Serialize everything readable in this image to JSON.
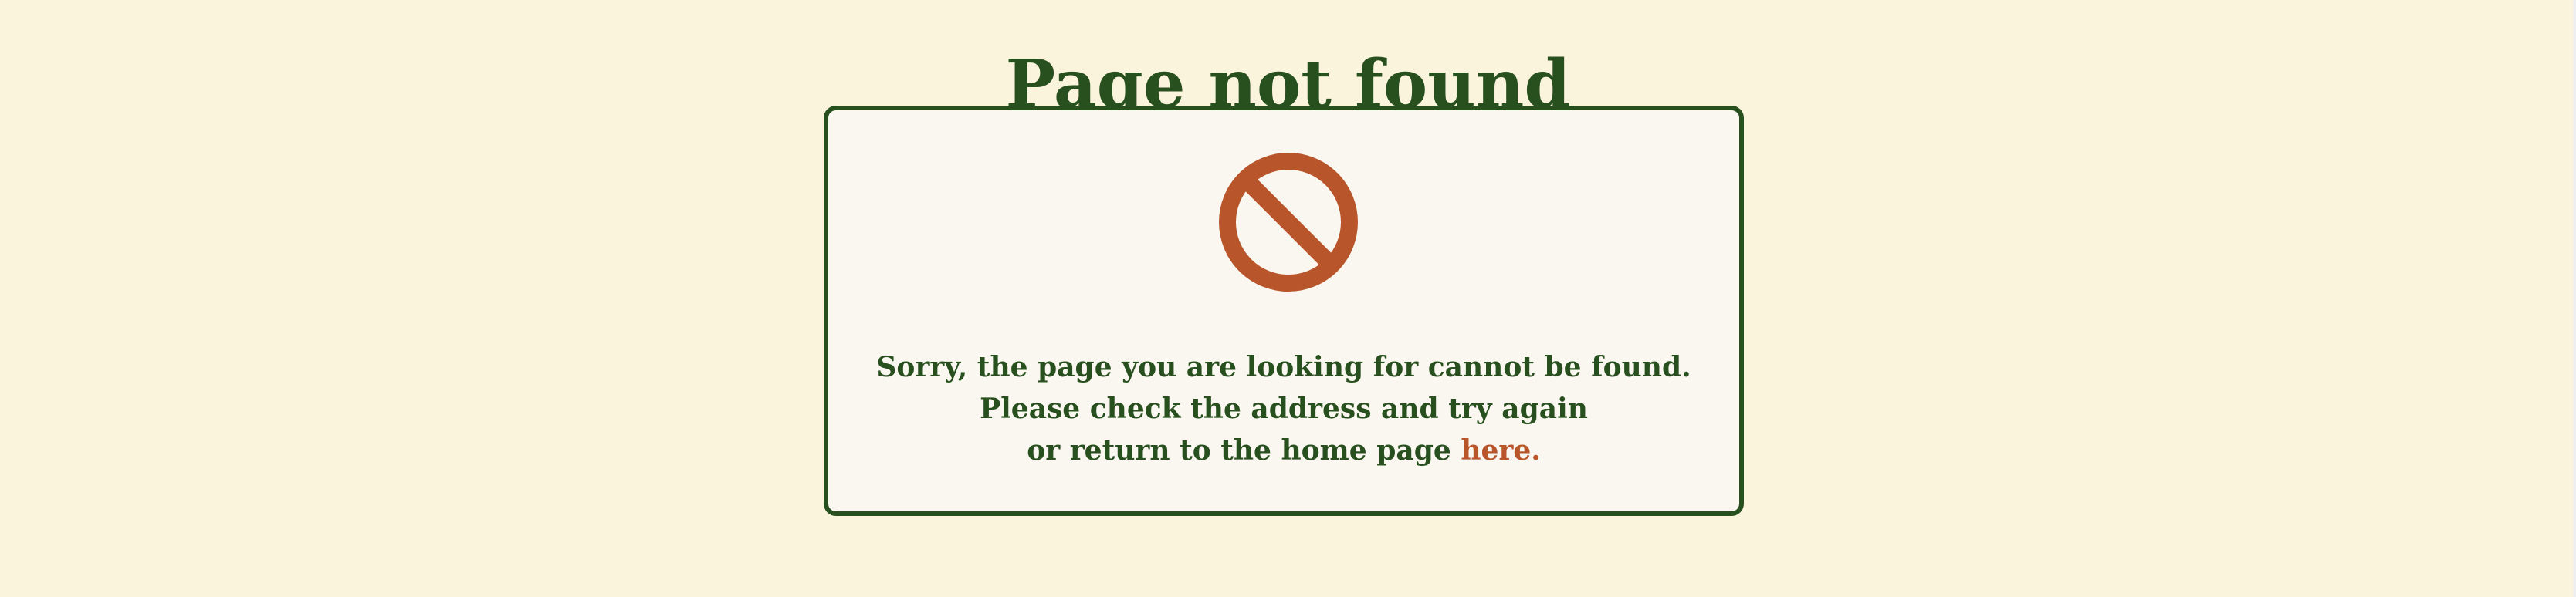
{
  "page": {
    "title": "Page not found",
    "message": {
      "line1": "Sorry, the page you are looking for cannot be found.",
      "line2": "Please check the address and try again",
      "line3_prefix": "or return to the home page",
      "link_text": "here."
    },
    "icon": "prohibited-icon"
  },
  "colors": {
    "background": "#fbf4dd",
    "card_background": "#faf7f0",
    "primary_green": "#28501f",
    "accent_orange": "#b8552a"
  }
}
